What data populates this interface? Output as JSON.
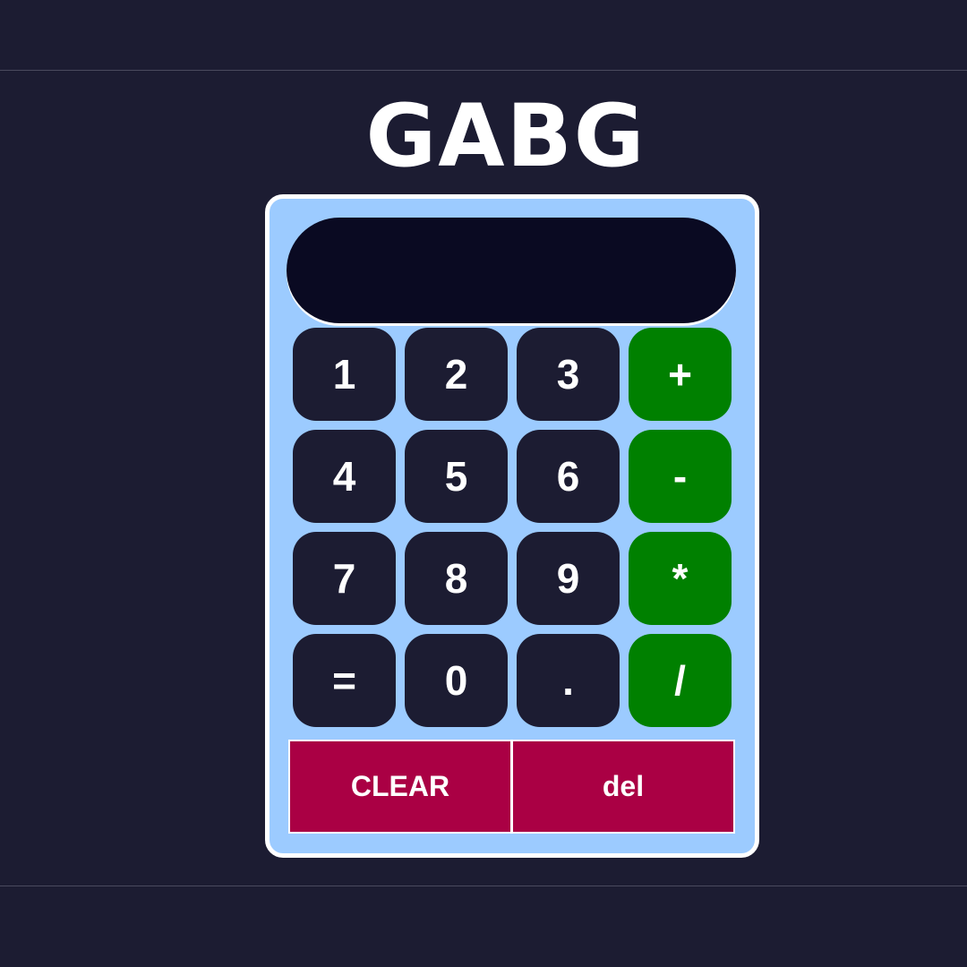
{
  "header": {
    "logo_text": "GABG"
  },
  "calculator": {
    "display_value": "",
    "keys": {
      "k1": "1",
      "k2": "2",
      "k3": "3",
      "plus": "+",
      "k4": "4",
      "k5": "5",
      "k6": "6",
      "minus": "-",
      "k7": "7",
      "k8": "8",
      "k9": "9",
      "multiply": "*",
      "equals": "=",
      "k0": "0",
      "decimal": ".",
      "divide": "/"
    },
    "clear_label": "CLEAR",
    "delete_label": "del"
  },
  "colors": {
    "page_background": "#1c1c32",
    "calculator_body": "#9ccbff",
    "display_background": "#0a0a22",
    "digit_key": "#1c1c32",
    "operator_key": "#008000",
    "action_key": "#aa0044",
    "text": "#ffffff"
  }
}
